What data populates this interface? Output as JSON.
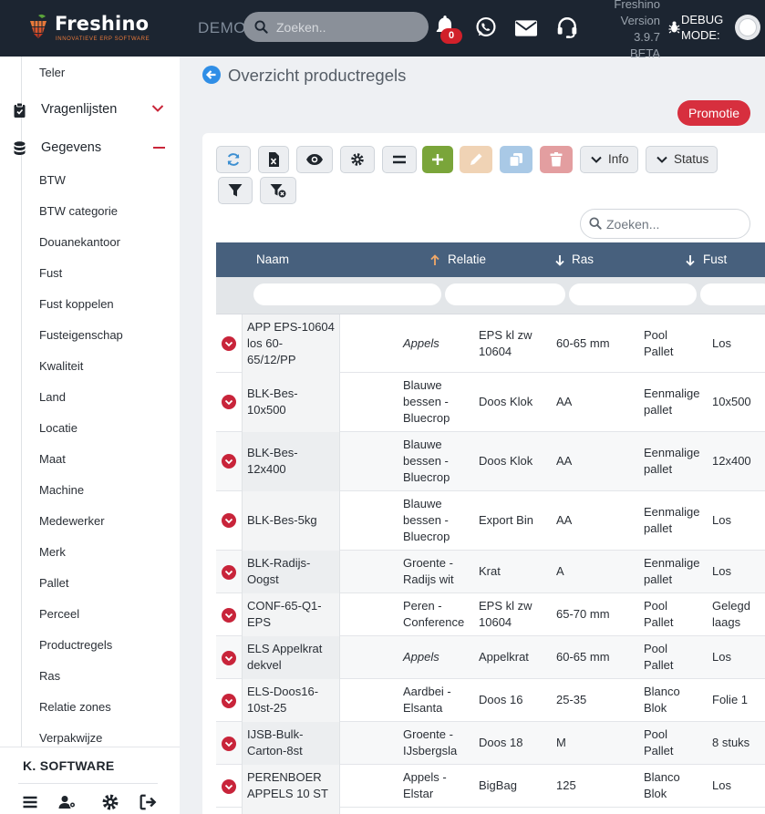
{
  "app": {
    "brand": "Freshino",
    "tagline": "INNOVATIEVE ERP SOFTWARE",
    "env_label": "DEMO",
    "version_lines": [
      "Freshino",
      "Version",
      "3.9.7",
      "BETA"
    ],
    "debug_label_1": "DEBUG",
    "debug_label_2": "MODE:",
    "search_placeholder": "Zoeken..",
    "notification_count": "0",
    "colors": {
      "topbar": "#1c2531",
      "accent": "#d72f3e",
      "header": "#47607d",
      "add": "#7aa53a"
    }
  },
  "sidebar": {
    "top_item": "Teler",
    "main_items": [
      {
        "label": "Vragenlijsten",
        "icon": "clipboard-icon",
        "state": "collapsed"
      },
      {
        "label": "Gegevens",
        "icon": "database-icon",
        "state": "expanded"
      }
    ],
    "sub_items": [
      "BTW",
      "BTW categorie",
      "Douanekantoor",
      "Fust",
      "Fust koppelen",
      "Fusteigenschap",
      "Kwaliteit",
      "Land",
      "Locatie",
      "Maat",
      "Machine",
      "Medewerker",
      "Merk",
      "Pallet",
      "Perceel",
      "Productregels",
      "Ras",
      "Relatie zones",
      "Verpakwijze"
    ],
    "company": "K. SOFTWARE",
    "footer_icons": [
      "menu-icon",
      "user-settings-icon",
      "settings-icon",
      "logout-icon"
    ]
  },
  "page": {
    "title": "Overzicht productregels",
    "promo_button": "Promotie"
  },
  "toolbar": {
    "info_label": "Info",
    "status_label": "Status",
    "search_placeholder": "Zoeken..."
  },
  "table": {
    "headers": {
      "naam": "Naam",
      "relatie": "Relatie",
      "ras": "Ras",
      "fust": "Fust"
    },
    "rows": [
      {
        "naam": "APP EPS-10604\nlos 60-\n65/12/PP",
        "relatie": "Appels",
        "relatie_italic": true,
        "fust": "EPS kl zw\n10604",
        "maat": "60-65 mm",
        "pallet": "Pool\nPallet",
        "extra": "Los"
      },
      {
        "naam": "BLK-Bes-\n10x500",
        "relatie": "Blauwe\nbessen -\nBluecrop",
        "relatie_italic": false,
        "fust": "Doos Klok",
        "maat": "AA",
        "pallet": "Eenmalige\npallet",
        "extra": "10x500"
      },
      {
        "naam": "BLK-Bes-\n12x400",
        "relatie": "Blauwe\nbessen -\nBluecrop",
        "relatie_italic": false,
        "fust": "Doos Klok",
        "maat": "AA",
        "pallet": "Eenmalige\npallet",
        "extra": "12x400"
      },
      {
        "naam": "BLK-Bes-5kg",
        "relatie": "Blauwe\nbessen -\nBluecrop",
        "relatie_italic": false,
        "fust": "Export Bin",
        "maat": "AA",
        "pallet": "Eenmalige\npallet",
        "extra": "Los"
      },
      {
        "naam": "BLK-Radijs-\nOogst",
        "relatie": "Groente -\nRadijs wit",
        "relatie_italic": false,
        "fust": "Krat",
        "maat": "A",
        "pallet": "Eenmalige\npallet",
        "extra": "Los"
      },
      {
        "naam": "CONF-65-Q1-\nEPS",
        "relatie": "Peren -\nConference",
        "relatie_italic": false,
        "fust": "EPS kl zw\n10604",
        "maat": "65-70 mm",
        "pallet": "Pool\nPallet",
        "extra": "Gelegd\nlaags"
      },
      {
        "naam": "ELS Appelkrat\ndekvel",
        "relatie": "Appels",
        "relatie_italic": true,
        "fust": "Appelkrat",
        "maat": "60-65 mm",
        "pallet": "Pool\nPallet",
        "extra": "Los"
      },
      {
        "naam": "ELS-Doos16-\n10st-25",
        "relatie": "Aardbei -\nElsanta",
        "relatie_italic": false,
        "fust": "Doos 16",
        "maat": "25-35",
        "pallet": "Blanco\nBlok",
        "extra": "Folie 1"
      },
      {
        "naam": "IJSB-Bulk-\nCarton-8st",
        "relatie": "Groente -\nIJsbergsla",
        "relatie_italic": false,
        "fust": "Doos 18",
        "maat": "M",
        "pallet": "Pool\nPallet",
        "extra": "8 stuks"
      },
      {
        "naam": "PERENBOER\nAPPELS 10 ST",
        "relatie": "Appels -\nElstar",
        "relatie_italic": false,
        "fust": "BigBag",
        "maat": "125",
        "pallet": "Blanco\nBlok",
        "extra": "Los"
      }
    ]
  }
}
